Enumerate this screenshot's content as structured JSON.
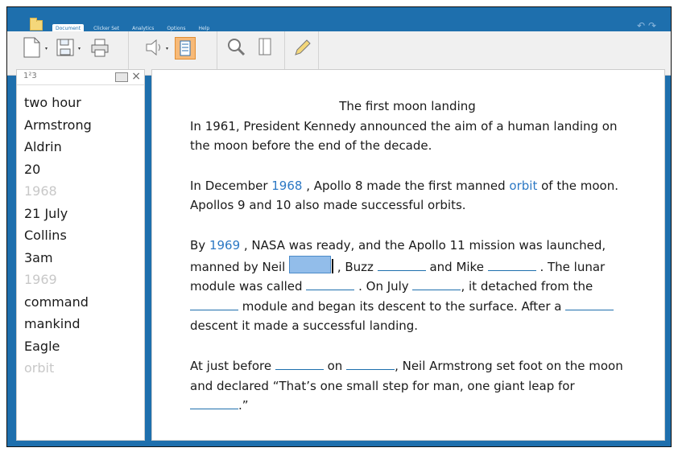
{
  "tabs": [
    {
      "label": "Document",
      "active": true
    },
    {
      "label": "Clicker Set",
      "active": false
    },
    {
      "label": "Analytics",
      "active": false
    },
    {
      "label": "Options",
      "active": false
    },
    {
      "label": "Help",
      "active": false
    }
  ],
  "ribbon_groups": {
    "file": "FILE",
    "support": "SUPPORT",
    "view": "VIEW",
    "edit": "EDIT"
  },
  "wordbank": {
    "header": "1²3",
    "items": [
      {
        "text": "two hour",
        "used": false
      },
      {
        "text": "Armstrong",
        "used": false
      },
      {
        "text": "Aldrin",
        "used": false
      },
      {
        "text": "20",
        "used": false
      },
      {
        "text": "1968",
        "used": true
      },
      {
        "text": "21 July",
        "used": false
      },
      {
        "text": "Collins",
        "used": false
      },
      {
        "text": "3am",
        "used": false
      },
      {
        "text": "1969",
        "used": true
      },
      {
        "text": "command",
        "used": false
      },
      {
        "text": "mankind",
        "used": false
      },
      {
        "text": "Eagle",
        "used": false
      },
      {
        "text": "orbit",
        "used": true
      }
    ]
  },
  "document": {
    "title": "The first moon landing",
    "p1": "In 1961, President Kennedy announced the aim of a human landing on the moon before the end of the decade.",
    "p2_a": "In December ",
    "p2_w1": "1968",
    "p2_b": " , Apollo 8 made the first manned ",
    "p2_w2": "orbit",
    "p2_c": " of the moon.  Apollos 9 and 10 also made successful orbits.",
    "p3_a": "By ",
    "p3_w1": "1969",
    "p3_b": " , NASA was ready, and the Apollo 11 mission was launched, manned by Neil ",
    "p3_c": " , Buzz ",
    "p3_d": " and Mike ",
    "p3_e": " . The lunar module was called ",
    "p3_f": " .  On July ",
    "p3_g": ", it detached from the ",
    "p3_h": " module and began its descent to the surface. After a ",
    "p3_i": " descent it made a successful landing.",
    "p4_a": "At just before ",
    "p4_b": " on ",
    "p4_c": ", Neil Armstrong set foot on the moon and declared “That’s one small step for man, one giant leap for ",
    "p4_d": ".”"
  }
}
